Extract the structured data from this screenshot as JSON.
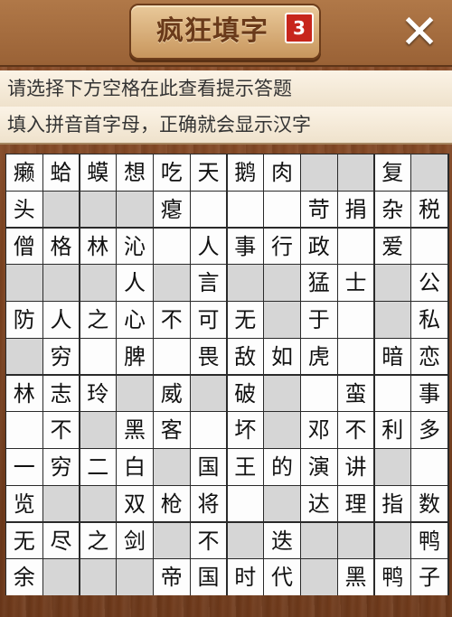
{
  "header": {
    "title": "疯狂填字",
    "level_badge": "3",
    "close_label": "✕"
  },
  "hints": {
    "line1": "请选择下方空格在此查看提示答题",
    "line2": "填入拼音首字母，正确就会显示汉字"
  },
  "puzzle": {
    "rows": 12,
    "cols": 12,
    "grid": [
      [
        "癞",
        "蛤",
        "蟆",
        "想",
        "吃",
        "天",
        "鹅",
        "肉",
        "#",
        "#",
        "复",
        "#"
      ],
      [
        "头",
        "#",
        "#",
        "#",
        "瘪",
        "",
        "",
        "",
        "苛",
        "捐",
        "杂",
        "税"
      ],
      [
        "僧",
        "格",
        "林",
        "沁",
        "",
        "人",
        "事",
        "行",
        "政",
        "",
        "爱",
        ""
      ],
      [
        "#",
        "#",
        "#",
        "人",
        "#",
        "言",
        "#",
        "#",
        "猛",
        "士",
        "#",
        "公"
      ],
      [
        "防",
        "人",
        "之",
        "心",
        "不",
        "可",
        "无",
        "#",
        "于",
        "",
        "#",
        "私"
      ],
      [
        "#",
        "穷",
        "",
        "脾",
        "",
        "畏",
        "敌",
        "如",
        "虎",
        "",
        "暗",
        "恋"
      ],
      [
        "林",
        "志",
        "玲",
        "#",
        "威",
        "#",
        "破",
        "#",
        "",
        "蛮",
        "",
        "事"
      ],
      [
        "",
        "不",
        "#",
        "黑",
        "客",
        "",
        "坏",
        "#",
        "邓",
        "不",
        "利",
        "多"
      ],
      [
        "一",
        "穷",
        "二",
        "白",
        "#",
        "国",
        "王",
        "的",
        "演",
        "讲",
        "#",
        ""
      ],
      [
        "览",
        "#",
        "#",
        "双",
        "枪",
        "将",
        "",
        "#",
        "达",
        "理",
        "指",
        "数"
      ],
      [
        "无",
        "尽",
        "之",
        "剑",
        "#",
        "不",
        "#",
        "迭",
        "#",
        "#",
        "#",
        "鸭"
      ],
      [
        "余",
        "#",
        "#",
        "#",
        "帝",
        "国",
        "时",
        "代",
        "#",
        "黑",
        "鸭",
        "子"
      ]
    ]
  }
}
